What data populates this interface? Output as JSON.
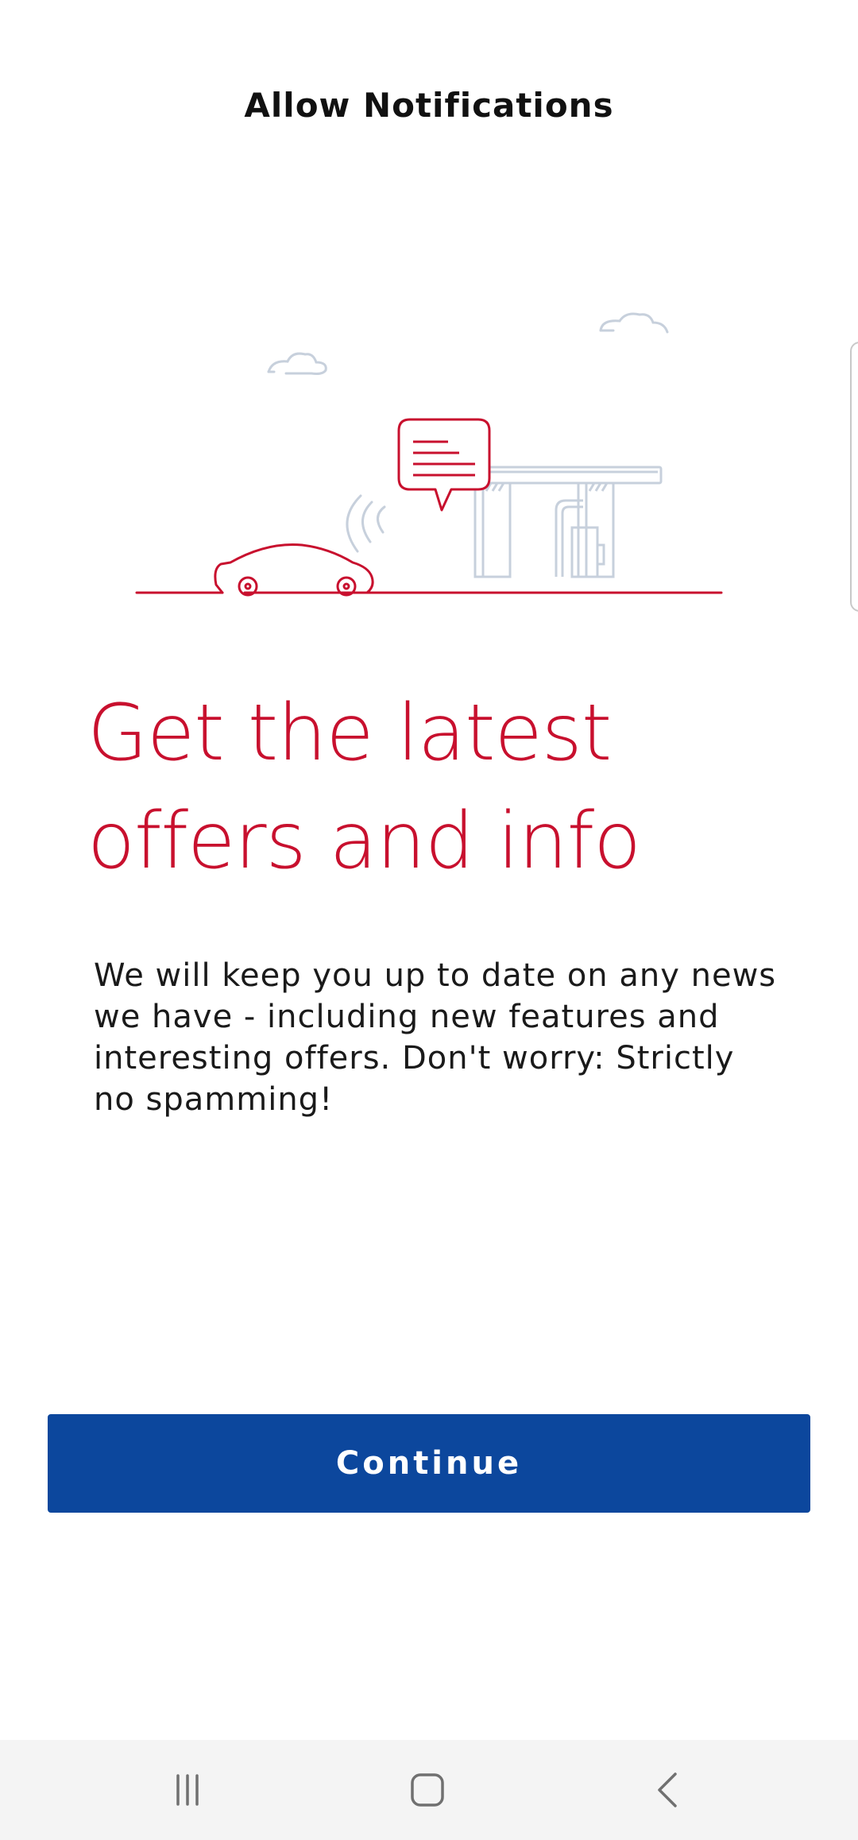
{
  "header": {
    "title": "Allow Notifications"
  },
  "illustration": {
    "icons": [
      "cloud-icon",
      "speech-bubble-icon",
      "car-icon",
      "gas-station-icon",
      "signal-waves-icon"
    ]
  },
  "main": {
    "headline_line1": "Get the latest",
    "headline_line2": "offers and info",
    "body": "We will keep you up to date on any news we have - including new features and interesting offers. Don't worry: Strictly no spamming!",
    "continue_label": "Continue"
  },
  "navbar": {
    "icons": [
      "recent-apps-icon",
      "home-icon",
      "back-icon"
    ]
  },
  "colors": {
    "accent_red": "#c8102e",
    "primary_blue": "#0c479d",
    "illustration_gray": "#c7d0dc",
    "text_dark": "#1a1a1a"
  }
}
